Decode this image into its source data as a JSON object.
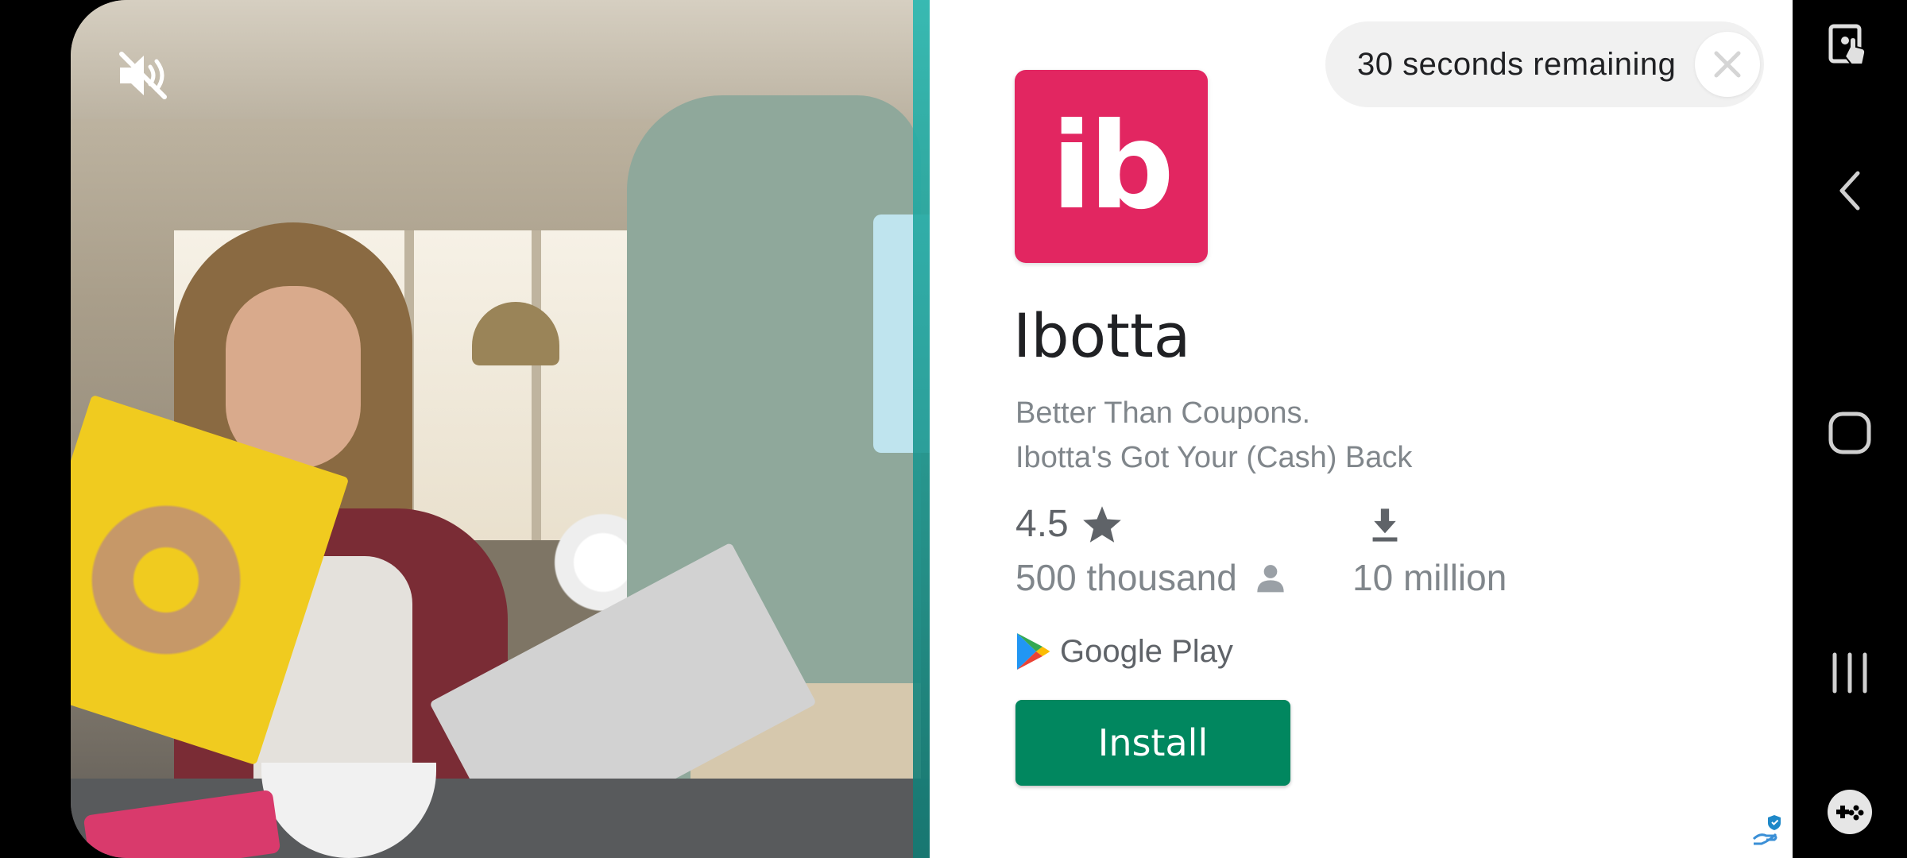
{
  "ad": {
    "timer_text": "30 seconds remaining",
    "app_icon_text": "ib",
    "app_name": "Ibotta",
    "tagline_line1": "Better Than Coupons.",
    "tagline_line2": "Ibotta's Got Your (Cash) Back",
    "rating": "4.5",
    "reviews": "500 thousand",
    "downloads": "10 million",
    "store_label": "Google Play",
    "install_label": "Install",
    "brand_color": "#e22661",
    "install_color": "#01875f"
  },
  "icons": {
    "mute": "volume-muted-icon",
    "close": "close-icon",
    "star": "star-icon",
    "person": "person-icon",
    "download": "download-icon",
    "google_play": "google-play-logo",
    "adchoices": "adchoices-icon",
    "nav_screenshot": "screen-touch-icon",
    "nav_back": "back-icon",
    "nav_home": "home-icon",
    "nav_recents": "recents-icon",
    "nav_game": "game-launcher-icon"
  }
}
